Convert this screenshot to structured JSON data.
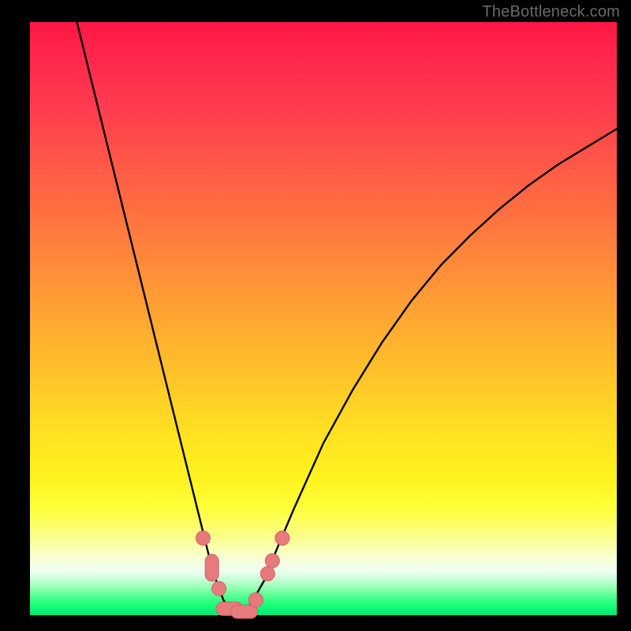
{
  "watermark": "TheBottleneck.com",
  "colors": {
    "background": "#000000",
    "curve": "#000000",
    "marker_fill": "#e77a7c",
    "marker_stroke": "#d46265"
  },
  "chart_data": {
    "type": "line",
    "title": "",
    "xlabel": "",
    "ylabel": "",
    "xlim": [
      0,
      100
    ],
    "ylim": [
      0,
      100
    ],
    "series": [
      {
        "name": "bottleneck-curve",
        "x": [
          8,
          10,
          12,
          14,
          16,
          18,
          20,
          22,
          24,
          26,
          28,
          30,
          31,
          32,
          33,
          34,
          35,
          36,
          37,
          38,
          40,
          42,
          45,
          50,
          55,
          60,
          65,
          70,
          75,
          80,
          85,
          90,
          95,
          100
        ],
        "y": [
          100,
          92,
          84,
          76,
          68,
          60,
          52,
          44,
          36,
          28,
          20,
          12,
          8,
          5,
          2.5,
          1,
          0.4,
          0.4,
          1,
          2.5,
          6,
          11,
          18,
          29,
          38,
          46,
          53,
          59,
          64,
          68.5,
          72.5,
          76,
          79,
          82
        ]
      }
    ],
    "markers": [
      {
        "shape": "circle",
        "x": 29.5,
        "y": 13.0
      },
      {
        "shape": "vcapsule",
        "x": 31.0,
        "y": 8.0
      },
      {
        "shape": "circle",
        "x": 32.2,
        "y": 4.5
      },
      {
        "shape": "hcapsule",
        "x": 34.0,
        "y": 1.1
      },
      {
        "shape": "hcapsule",
        "x": 36.5,
        "y": 0.6
      },
      {
        "shape": "circle",
        "x": 38.5,
        "y": 2.6
      },
      {
        "shape": "circle",
        "x": 40.5,
        "y": 7.0
      },
      {
        "shape": "circle",
        "x": 41.3,
        "y": 9.2
      },
      {
        "shape": "circle",
        "x": 43.0,
        "y": 13.0
      }
    ]
  }
}
